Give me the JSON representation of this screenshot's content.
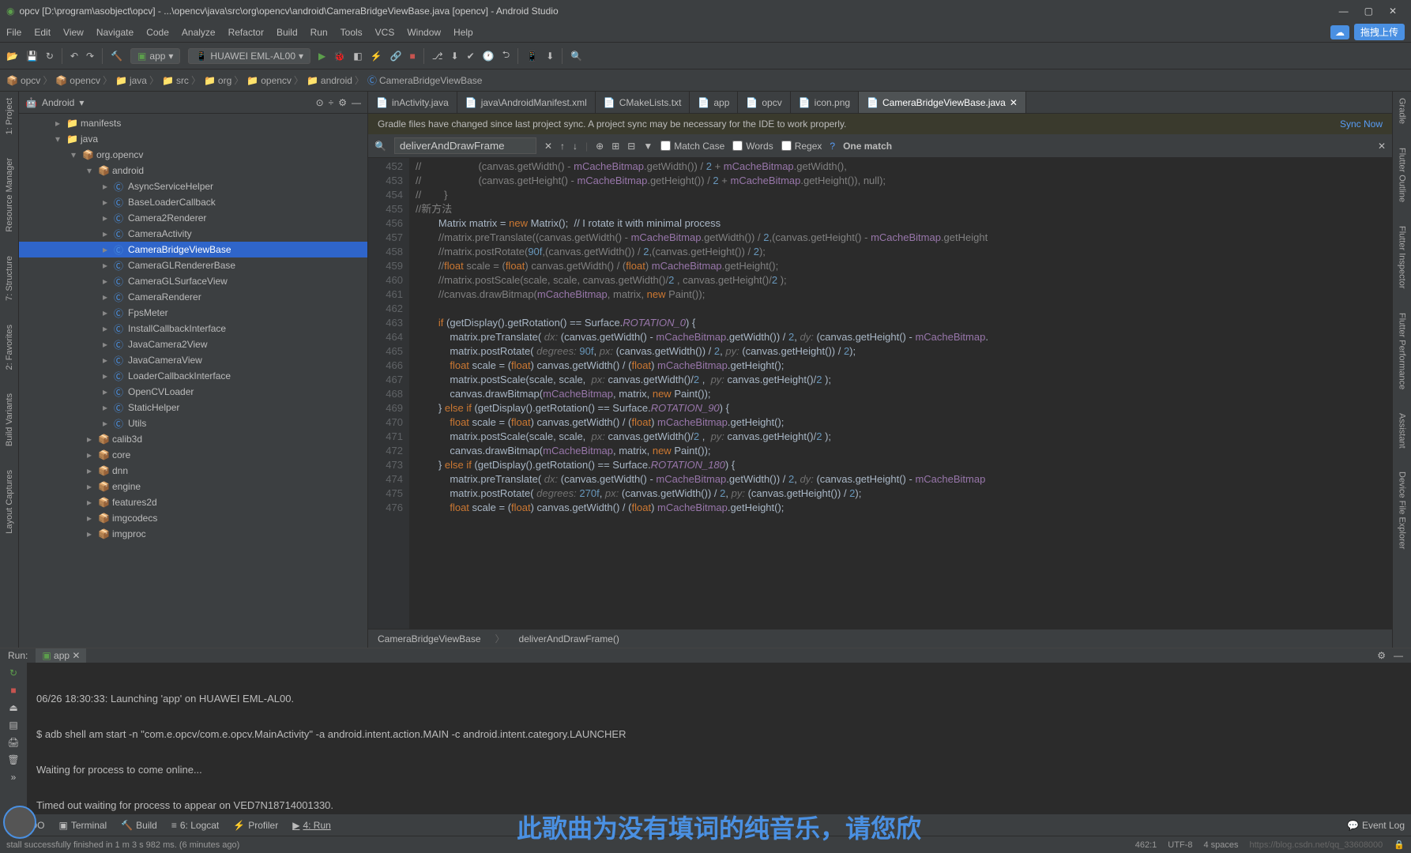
{
  "title": "opcv [D:\\program\\asobject\\opcv] - ...\\opencv\\java\\src\\org\\opencv\\android\\CameraBridgeViewBase.java [opencv] - Android Studio",
  "menu": [
    "File",
    "Edit",
    "View",
    "Navigate",
    "Code",
    "Analyze",
    "Refactor",
    "Build",
    "Run",
    "Tools",
    "VCS",
    "Window",
    "Help"
  ],
  "upload_label": "拖拽上传",
  "toolbar": {
    "app": "app",
    "device": "HUAWEI EML-AL00"
  },
  "breadcrumb": [
    "opcv",
    "opencv",
    "java",
    "src",
    "org",
    "opencv",
    "android",
    "CameraBridgeViewBase"
  ],
  "sidetabs_left": [
    "1: Project",
    "Resource Manager",
    "7: Structure",
    "2: Favorites",
    "Build Variants",
    "Layout Captures"
  ],
  "sidetabs_right": [
    "Gradle",
    "Flutter Outline",
    "Flutter Inspector",
    "Flutter Performance",
    "Assistant",
    "Device File Explorer"
  ],
  "tree_head": "Android",
  "tree": [
    {
      "ind": 46,
      "arrow": "▸",
      "icon": "📁",
      "label": "manifests"
    },
    {
      "ind": 46,
      "arrow": "▾",
      "icon": "📁",
      "label": "java"
    },
    {
      "ind": 66,
      "arrow": "▾",
      "icon": "📦",
      "label": "org.opencv"
    },
    {
      "ind": 86,
      "arrow": "▾",
      "icon": "📦",
      "label": "android"
    },
    {
      "ind": 106,
      "arrow": "▸",
      "class": true,
      "label": "AsyncServiceHelper"
    },
    {
      "ind": 106,
      "arrow": "▸",
      "class": true,
      "label": "BaseLoaderCallback"
    },
    {
      "ind": 106,
      "arrow": "▸",
      "class": true,
      "label": "Camera2Renderer"
    },
    {
      "ind": 106,
      "arrow": "▸",
      "class": true,
      "label": "CameraActivity"
    },
    {
      "ind": 106,
      "arrow": "▸",
      "class": true,
      "label": "CameraBridgeViewBase",
      "sel": true
    },
    {
      "ind": 106,
      "arrow": "▸",
      "class": true,
      "label": "CameraGLRendererBase"
    },
    {
      "ind": 106,
      "arrow": "▸",
      "class": true,
      "label": "CameraGLSurfaceView"
    },
    {
      "ind": 106,
      "arrow": "▸",
      "class": true,
      "label": "CameraRenderer"
    },
    {
      "ind": 106,
      "arrow": "▸",
      "class": true,
      "label": "FpsMeter"
    },
    {
      "ind": 106,
      "arrow": "▸",
      "class": true,
      "label": "InstallCallbackInterface"
    },
    {
      "ind": 106,
      "arrow": "▸",
      "class": true,
      "label": "JavaCamera2View"
    },
    {
      "ind": 106,
      "arrow": "▸",
      "class": true,
      "label": "JavaCameraView"
    },
    {
      "ind": 106,
      "arrow": "▸",
      "class": true,
      "label": "LoaderCallbackInterface"
    },
    {
      "ind": 106,
      "arrow": "▸",
      "class": true,
      "label": "OpenCVLoader"
    },
    {
      "ind": 106,
      "arrow": "▸",
      "class": true,
      "label": "StaticHelper"
    },
    {
      "ind": 106,
      "arrow": "▸",
      "class": true,
      "label": "Utils"
    },
    {
      "ind": 86,
      "arrow": "▸",
      "icon": "📦",
      "label": "calib3d"
    },
    {
      "ind": 86,
      "arrow": "▸",
      "icon": "📦",
      "label": "core"
    },
    {
      "ind": 86,
      "arrow": "▸",
      "icon": "📦",
      "label": "dnn"
    },
    {
      "ind": 86,
      "arrow": "▸",
      "icon": "📦",
      "label": "engine"
    },
    {
      "ind": 86,
      "arrow": "▸",
      "icon": "📦",
      "label": "features2d"
    },
    {
      "ind": 86,
      "arrow": "▸",
      "icon": "📦",
      "label": "imgcodecs"
    },
    {
      "ind": 86,
      "arrow": "▸",
      "icon": "📦",
      "label": "imgproc"
    }
  ],
  "tabs": [
    {
      "label": "inActivity.java"
    },
    {
      "label": "java\\AndroidManifest.xml"
    },
    {
      "label": "CMakeLists.txt"
    },
    {
      "label": "app"
    },
    {
      "label": "opcv"
    },
    {
      "label": "icon.png"
    },
    {
      "label": "CameraBridgeViewBase.java",
      "active": true
    }
  ],
  "banner": {
    "msg": "Gradle files have changed since last project sync. A project sync may be necessary for the IDE to work properly.",
    "action": "Sync Now"
  },
  "find": {
    "query": "deliverAndDrawFrame",
    "match_case": "Match Case",
    "words": "Words",
    "regex": "Regex",
    "result": "One match"
  },
  "code": {
    "start": 452,
    "lines": [
      "//                    (canvas.getWidth() - mCacheBitmap.getWidth()) / 2 + mCacheBitmap.getWidth(),",
      "//                    (canvas.getHeight() - mCacheBitmap.getHeight()) / 2 + mCacheBitmap.getHeight()), null);",
      "//        }",
      "//新方法",
      "        Matrix matrix = new Matrix();  // I rotate it with minimal process",
      "        //matrix.preTranslate((canvas.getWidth() - mCacheBitmap.getWidth()) / 2,(canvas.getHeight() - mCacheBitmap.getHeight",
      "        //matrix.postRotate(90f,(canvas.getWidth()) / 2,(canvas.getHeight()) / 2);",
      "        //float scale = (float) canvas.getWidth() / (float) mCacheBitmap.getHeight();",
      "        //matrix.postScale(scale, scale, canvas.getWidth()/2 , canvas.getHeight()/2 );",
      "        //canvas.drawBitmap(mCacheBitmap, matrix, new Paint());",
      "",
      "        if (getDisplay().getRotation() == Surface.ROTATION_0) {",
      "            matrix.preTranslate( dx: (canvas.getWidth() - mCacheBitmap.getWidth()) / 2, dy: (canvas.getHeight() - mCacheBitmap.",
      "            matrix.postRotate( degrees: 90f, px: (canvas.getWidth()) / 2, py: (canvas.getHeight()) / 2);",
      "            float scale = (float) canvas.getWidth() / (float) mCacheBitmap.getHeight();",
      "            matrix.postScale(scale, scale,  px: canvas.getWidth()/2 ,  py: canvas.getHeight()/2 );",
      "            canvas.drawBitmap(mCacheBitmap, matrix, new Paint());",
      "        } else if (getDisplay().getRotation() == Surface.ROTATION_90) {",
      "            float scale = (float) canvas.getWidth() / (float) mCacheBitmap.getHeight();",
      "            matrix.postScale(scale, scale,  px: canvas.getWidth()/2 ,  py: canvas.getHeight()/2 );",
      "            canvas.drawBitmap(mCacheBitmap, matrix, new Paint());",
      "        } else if (getDisplay().getRotation() == Surface.ROTATION_180) {",
      "            matrix.preTranslate( dx: (canvas.getWidth() - mCacheBitmap.getWidth()) / 2, dy: (canvas.getHeight() - mCacheBitmap",
      "            matrix.postRotate( degrees: 270f, px: (canvas.getWidth()) / 2, py: (canvas.getHeight()) / 2);",
      "            float scale = (float) canvas.getWidth() / (float) mCacheBitmap.getHeight();"
    ]
  },
  "nav": {
    "class": "CameraBridgeViewBase",
    "method": "deliverAndDrawFrame()"
  },
  "run": {
    "title": "Run:",
    "tab": "app",
    "out": [
      "06/26 18:30:33: Launching 'app' on HUAWEI EML-AL00.",
      "$ adb shell am start -n \"com.e.opcv/com.e.opcv.MainActivity\" -a android.intent.action.MAIN -c android.intent.category.LAUNCHER",
      "Waiting for process to come online...",
      "Timed out waiting for process to appear on VED7N18714001330."
    ],
    "lyric": "此歌曲为没有填词的纯音乐，请您欣"
  },
  "bottom": {
    "todo": "TODO",
    "terminal": "Terminal",
    "build": "Build",
    "logcat": "6: Logcat",
    "profiler": "Profiler",
    "run": "4: Run",
    "event": "Event Log"
  },
  "status": {
    "msg": "stall successfully finished in 1 m 3 s 982 ms. (6 minutes ago)",
    "pos": "462:1",
    "enc": "UTF-8",
    "indent": "4 spaces",
    "watermark": "https://blog.csdn.net/qq_33608000"
  }
}
